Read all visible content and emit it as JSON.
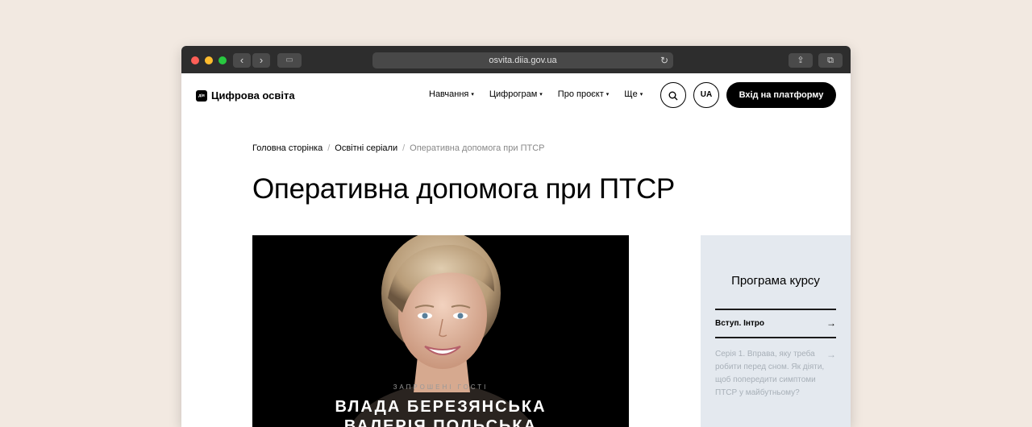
{
  "browser": {
    "url": "osvita.diia.gov.ua",
    "back_glyph": "‹",
    "forward_glyph": "›",
    "reload_glyph": "↻",
    "share_glyph": "⇪",
    "tabs_glyph": "⧉",
    "sidebar_glyph": "▭"
  },
  "header": {
    "logo_mark": "дія",
    "logo_text": "Цифрова освіта",
    "menu": [
      {
        "label": "Навчання"
      },
      {
        "label": "Цифрограм"
      },
      {
        "label": "Про проєкт"
      },
      {
        "label": "Ще"
      }
    ],
    "caret": "▾",
    "search_glyph": "⌕",
    "lang": "UA",
    "login": "Вхід на платформу"
  },
  "breadcrumb": {
    "items": [
      "Головна сторінка",
      "Освітні серіали",
      "Оперативна допомога при ПТСР"
    ],
    "separator": "/"
  },
  "page": {
    "title": "Оперативна допомога при ПТСР"
  },
  "video": {
    "caption": "ЗАПРОШЕНІ ГОСТІ",
    "guest_1": "ВЛАДА БЕРЕЗЯНСЬКА",
    "guest_2": "ВАЛЕРІЯ ПОЛЬСЬКА"
  },
  "program": {
    "title": "Програма курсу",
    "lessons": [
      {
        "label": "Вступ. Інтро"
      },
      {
        "label": "Серія 1. Вправа, яку треба робити перед сном. Як діяти, щоб попередити симптоми ПТСР у майбутньому?"
      }
    ],
    "arrow": "→"
  },
  "colors": {
    "page_bg": "#f2e9e1",
    "titlebar": "#2d2d2d",
    "program_bg": "#e4e9ef",
    "button_black": "#000000"
  }
}
